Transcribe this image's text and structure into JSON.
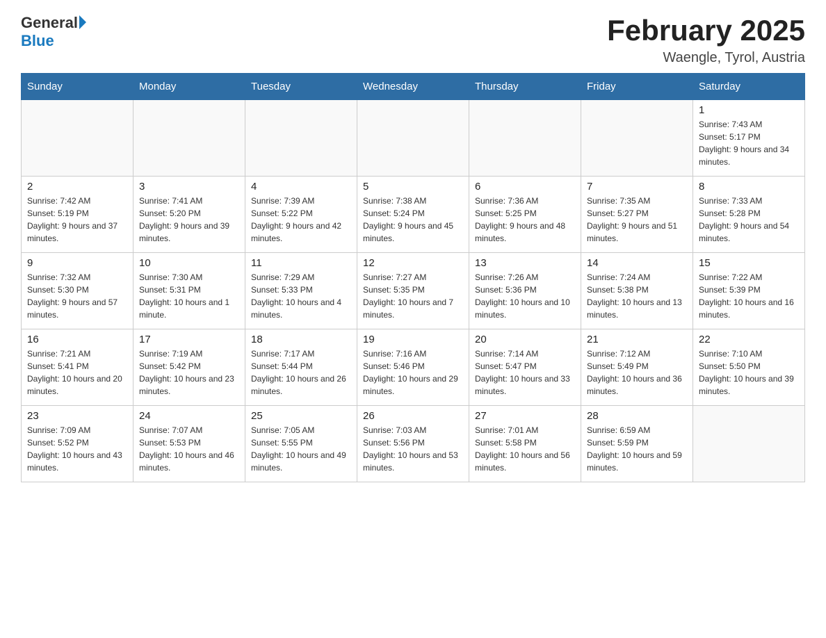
{
  "header": {
    "logo_general": "General",
    "logo_blue": "Blue",
    "month_year": "February 2025",
    "location": "Waengle, Tyrol, Austria"
  },
  "days_of_week": [
    "Sunday",
    "Monday",
    "Tuesday",
    "Wednesday",
    "Thursday",
    "Friday",
    "Saturday"
  ],
  "weeks": [
    [
      {
        "day": "",
        "info": ""
      },
      {
        "day": "",
        "info": ""
      },
      {
        "day": "",
        "info": ""
      },
      {
        "day": "",
        "info": ""
      },
      {
        "day": "",
        "info": ""
      },
      {
        "day": "",
        "info": ""
      },
      {
        "day": "1",
        "info": "Sunrise: 7:43 AM\nSunset: 5:17 PM\nDaylight: 9 hours and 34 minutes."
      }
    ],
    [
      {
        "day": "2",
        "info": "Sunrise: 7:42 AM\nSunset: 5:19 PM\nDaylight: 9 hours and 37 minutes."
      },
      {
        "day": "3",
        "info": "Sunrise: 7:41 AM\nSunset: 5:20 PM\nDaylight: 9 hours and 39 minutes."
      },
      {
        "day": "4",
        "info": "Sunrise: 7:39 AM\nSunset: 5:22 PM\nDaylight: 9 hours and 42 minutes."
      },
      {
        "day": "5",
        "info": "Sunrise: 7:38 AM\nSunset: 5:24 PM\nDaylight: 9 hours and 45 minutes."
      },
      {
        "day": "6",
        "info": "Sunrise: 7:36 AM\nSunset: 5:25 PM\nDaylight: 9 hours and 48 minutes."
      },
      {
        "day": "7",
        "info": "Sunrise: 7:35 AM\nSunset: 5:27 PM\nDaylight: 9 hours and 51 minutes."
      },
      {
        "day": "8",
        "info": "Sunrise: 7:33 AM\nSunset: 5:28 PM\nDaylight: 9 hours and 54 minutes."
      }
    ],
    [
      {
        "day": "9",
        "info": "Sunrise: 7:32 AM\nSunset: 5:30 PM\nDaylight: 9 hours and 57 minutes."
      },
      {
        "day": "10",
        "info": "Sunrise: 7:30 AM\nSunset: 5:31 PM\nDaylight: 10 hours and 1 minute."
      },
      {
        "day": "11",
        "info": "Sunrise: 7:29 AM\nSunset: 5:33 PM\nDaylight: 10 hours and 4 minutes."
      },
      {
        "day": "12",
        "info": "Sunrise: 7:27 AM\nSunset: 5:35 PM\nDaylight: 10 hours and 7 minutes."
      },
      {
        "day": "13",
        "info": "Sunrise: 7:26 AM\nSunset: 5:36 PM\nDaylight: 10 hours and 10 minutes."
      },
      {
        "day": "14",
        "info": "Sunrise: 7:24 AM\nSunset: 5:38 PM\nDaylight: 10 hours and 13 minutes."
      },
      {
        "day": "15",
        "info": "Sunrise: 7:22 AM\nSunset: 5:39 PM\nDaylight: 10 hours and 16 minutes."
      }
    ],
    [
      {
        "day": "16",
        "info": "Sunrise: 7:21 AM\nSunset: 5:41 PM\nDaylight: 10 hours and 20 minutes."
      },
      {
        "day": "17",
        "info": "Sunrise: 7:19 AM\nSunset: 5:42 PM\nDaylight: 10 hours and 23 minutes."
      },
      {
        "day": "18",
        "info": "Sunrise: 7:17 AM\nSunset: 5:44 PM\nDaylight: 10 hours and 26 minutes."
      },
      {
        "day": "19",
        "info": "Sunrise: 7:16 AM\nSunset: 5:46 PM\nDaylight: 10 hours and 29 minutes."
      },
      {
        "day": "20",
        "info": "Sunrise: 7:14 AM\nSunset: 5:47 PM\nDaylight: 10 hours and 33 minutes."
      },
      {
        "day": "21",
        "info": "Sunrise: 7:12 AM\nSunset: 5:49 PM\nDaylight: 10 hours and 36 minutes."
      },
      {
        "day": "22",
        "info": "Sunrise: 7:10 AM\nSunset: 5:50 PM\nDaylight: 10 hours and 39 minutes."
      }
    ],
    [
      {
        "day": "23",
        "info": "Sunrise: 7:09 AM\nSunset: 5:52 PM\nDaylight: 10 hours and 43 minutes."
      },
      {
        "day": "24",
        "info": "Sunrise: 7:07 AM\nSunset: 5:53 PM\nDaylight: 10 hours and 46 minutes."
      },
      {
        "day": "25",
        "info": "Sunrise: 7:05 AM\nSunset: 5:55 PM\nDaylight: 10 hours and 49 minutes."
      },
      {
        "day": "26",
        "info": "Sunrise: 7:03 AM\nSunset: 5:56 PM\nDaylight: 10 hours and 53 minutes."
      },
      {
        "day": "27",
        "info": "Sunrise: 7:01 AM\nSunset: 5:58 PM\nDaylight: 10 hours and 56 minutes."
      },
      {
        "day": "28",
        "info": "Sunrise: 6:59 AM\nSunset: 5:59 PM\nDaylight: 10 hours and 59 minutes."
      },
      {
        "day": "",
        "info": ""
      }
    ]
  ]
}
